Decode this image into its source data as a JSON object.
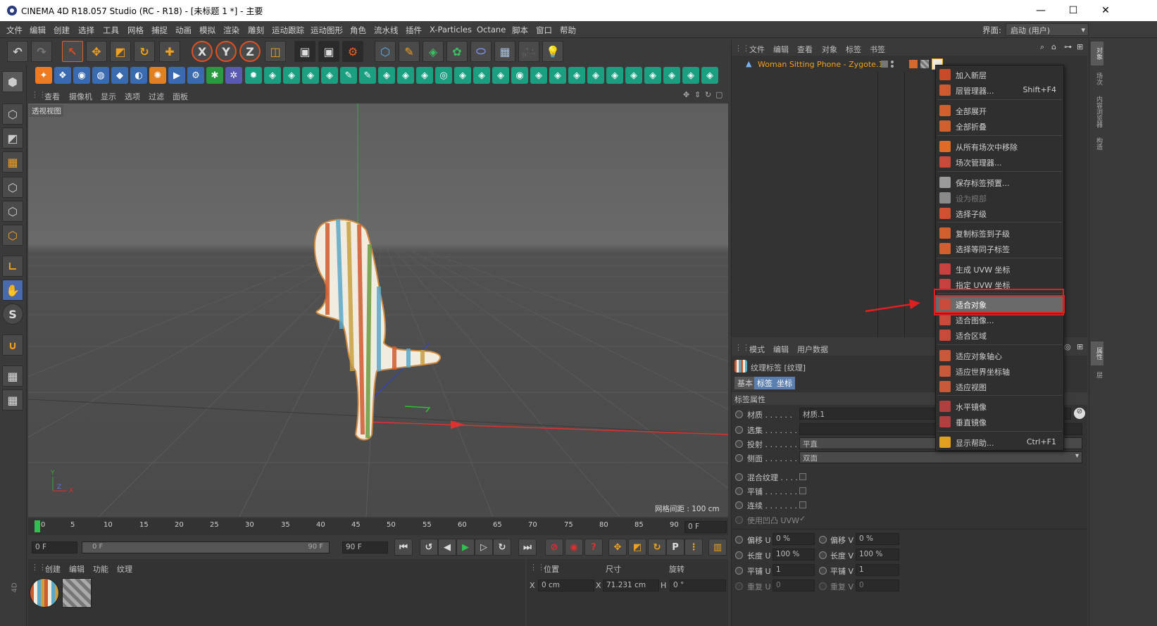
{
  "window": {
    "title": "CINEMA 4D R18.057 Studio (RC - R18) - [未标题 1 *] - 主要",
    "minimize": "—",
    "maximize": "☐",
    "close": "✕"
  },
  "menu": [
    "文件",
    "编辑",
    "创建",
    "选择",
    "工具",
    "网格",
    "捕捉",
    "动画",
    "模拟",
    "渲染",
    "雕刻",
    "运动跟踪",
    "运动图形",
    "角色",
    "流水线",
    "插件",
    "X-Particles",
    "Octane",
    "脚本",
    "窗口",
    "帮助"
  ],
  "layout": {
    "label": "界面:",
    "value": "启动 (用户)"
  },
  "viewport": {
    "menu": [
      "查看",
      "摄像机",
      "显示",
      "选项",
      "过滤",
      "面板"
    ],
    "name": "透视视图",
    "grid_spacing": "网格间距 : 100 cm",
    "axis": {
      "y": "Y",
      "z": "Z",
      "x": "X"
    }
  },
  "object_manager": {
    "menu": [
      "文件",
      "编辑",
      "查看",
      "对象",
      "标签",
      "书签"
    ],
    "object_name": "Woman Sitting Phone - Zygote.1"
  },
  "context_menu": {
    "items": [
      {
        "label": "加入新层",
        "shortcut": "",
        "color": "#c94a2a",
        "disabled": false
      },
      {
        "label": "层管理器...",
        "shortcut": "Shift+F4",
        "color": "#d05a30",
        "disabled": false
      },
      {
        "label": "全部展开",
        "shortcut": "",
        "color": "#d06030",
        "disabled": false
      },
      {
        "label": "全部折叠",
        "shortcut": "",
        "color": "#d06030",
        "disabled": false
      },
      {
        "label": "从所有场次中移除",
        "shortcut": "",
        "color": "#e06a2a",
        "disabled": false
      },
      {
        "label": "场次管理器...",
        "shortcut": "",
        "color": "#c84a3a",
        "disabled": false
      },
      {
        "label": "保存标签预置...",
        "shortcut": "",
        "color": "#9a9a9a",
        "disabled": false
      },
      {
        "label": "设为根部",
        "shortcut": "",
        "color": "#8a8a8a",
        "disabled": true
      },
      {
        "label": "选择子级",
        "shortcut": "",
        "color": "#d05030",
        "disabled": false
      },
      {
        "label": "复制标签到子级",
        "shortcut": "",
        "color": "#d06030",
        "disabled": false
      },
      {
        "label": "选择等同子标签",
        "shortcut": "",
        "color": "#d06030",
        "disabled": false
      },
      {
        "label": "生成 UVW 坐标",
        "shortcut": "",
        "color": "#c84040",
        "disabled": false
      },
      {
        "label": "指定 UVW 坐标",
        "shortcut": "",
        "color": "#c84040",
        "disabled": false
      },
      {
        "label": "适合对象",
        "shortcut": "",
        "color": "#c84a3a",
        "disabled": false
      },
      {
        "label": "适合图像...",
        "shortcut": "",
        "color": "#c84a3a",
        "disabled": false
      },
      {
        "label": "适合区域",
        "shortcut": "",
        "color": "#c84a3a",
        "disabled": false
      },
      {
        "label": "适应对象轴心",
        "shortcut": "",
        "color": "#c85a3a",
        "disabled": false
      },
      {
        "label": "适应世界坐标轴",
        "shortcut": "",
        "color": "#c85a3a",
        "disabled": false
      },
      {
        "label": "适应视图",
        "shortcut": "",
        "color": "#c85a3a",
        "disabled": false
      },
      {
        "label": "水平镜像",
        "shortcut": "",
        "color": "#b04040",
        "disabled": false
      },
      {
        "label": "垂直镜像",
        "shortcut": "",
        "color": "#b04040",
        "disabled": false
      },
      {
        "label": "显示帮助...",
        "shortcut": "Ctrl+F1",
        "color": "#e0a020",
        "disabled": false
      }
    ]
  },
  "attributes": {
    "menu": [
      "模式",
      "编辑",
      "用户数据"
    ],
    "title": "纹理标签 [纹理]",
    "tabs": [
      "基本",
      "标签",
      "坐标"
    ],
    "section": "标签属性",
    "rows": [
      {
        "label": "材质 . . . . . .",
        "value": "材质.1"
      },
      {
        "label": "选集 . . . . . . .",
        "value": ""
      },
      {
        "label": "投射 . . . . . . .",
        "value": "平直"
      },
      {
        "label": "侧面 . . . . . . .",
        "value": "双面"
      }
    ],
    "checks": [
      "混合纹理 . . . . .",
      "平铺 . . . . . . .",
      "连续 . . . . . . .",
      "使用凹凸 UVW"
    ],
    "coords": [
      {
        "l1": "偏移 U",
        "v1": "0 %",
        "l2": "偏移 V",
        "v2": "0 %"
      },
      {
        "l1": "长度 U",
        "v1": "100 %",
        "l2": "长度 V",
        "v2": "100 %"
      },
      {
        "l1": "平铺 U",
        "v1": "1",
        "l2": "平铺 V",
        "v2": "1"
      },
      {
        "l1": "重复 U",
        "v1": "0",
        "l2": "重复 V",
        "v2": "0"
      }
    ]
  },
  "timeline": {
    "ticks": [
      "0",
      "5",
      "10",
      "15",
      "20",
      "25",
      "30",
      "35",
      "40",
      "45",
      "50",
      "55",
      "60",
      "65",
      "70",
      "75",
      "80",
      "85",
      "90"
    ],
    "frame": "0 F",
    "start": "0 F",
    "range_start": "0 F",
    "range_end": "90 F",
    "end": "90 F"
  },
  "material_manager": {
    "menu": [
      "创建",
      "编辑",
      "功能",
      "纹理"
    ]
  },
  "coordinates": {
    "headers": [
      "位置",
      "尺寸",
      "旋转"
    ],
    "x_label": "X",
    "x_pos": "0 cm",
    "x_size_label": "X",
    "x_size": "71.231 cm",
    "h_label": "H",
    "h_rot": "0 °"
  },
  "right_tabs": [
    "对象",
    "场次",
    "内容浏览器",
    "构造",
    "属性",
    "层"
  ],
  "side_label": "4D"
}
